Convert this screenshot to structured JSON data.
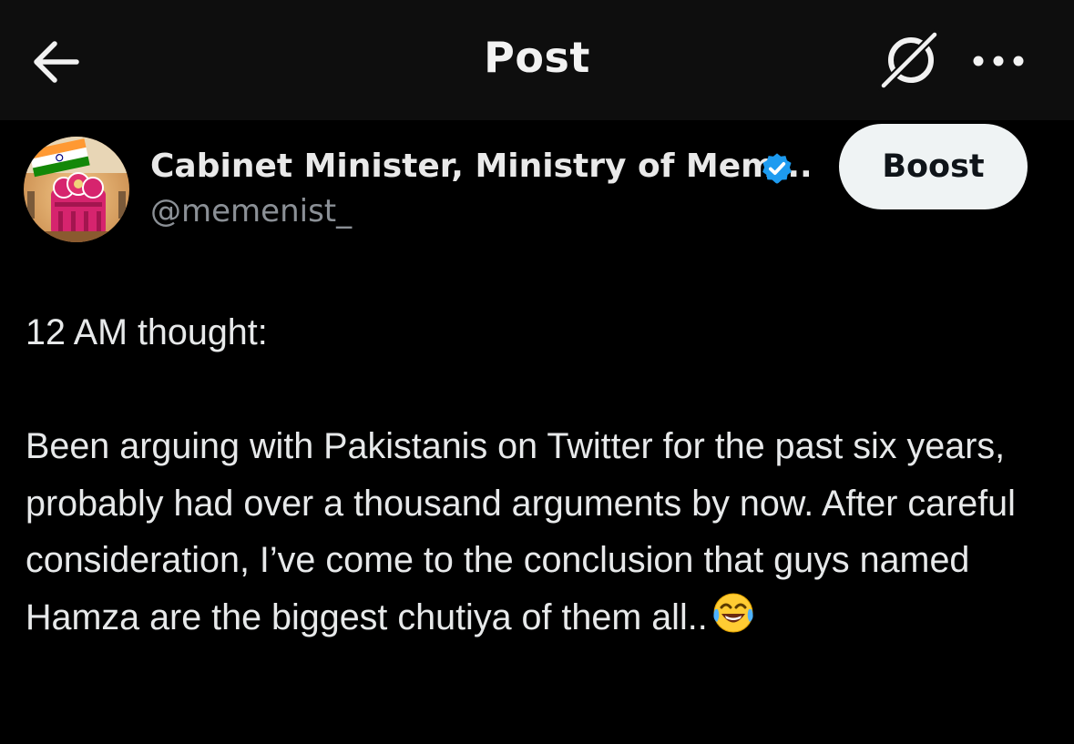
{
  "header": {
    "title": "Post",
    "back_icon": "arrow-left-icon",
    "grok_icon": "grok-icon",
    "more_icon": "more-horizontal-icon"
  },
  "author": {
    "display_name": "Cabinet Minister, Ministry of Mem...",
    "handle": "@memenist_",
    "verified": true,
    "verified_icon": "verified-badge-icon",
    "verified_color": "#1d9bf0"
  },
  "actions": {
    "boost_label": "Boost"
  },
  "post": {
    "line1": "12 AM thought:",
    "line2": "Been arguing with Pakistanis on Twitter for the past six years, probably had over a thousand arguments by now. After careful consideration, I’ve come to the conclusion that guys named Hamza are the biggest chutiya of them all..",
    "trailing_emoji": "face-with-tears-of-joy"
  },
  "colors": {
    "background": "#000000",
    "header_background": "#0e0e0e",
    "text": "#e7e9ea",
    "secondary_text": "#8b9096",
    "boost_background": "#eff3f4",
    "boost_text": "#0f1419"
  }
}
